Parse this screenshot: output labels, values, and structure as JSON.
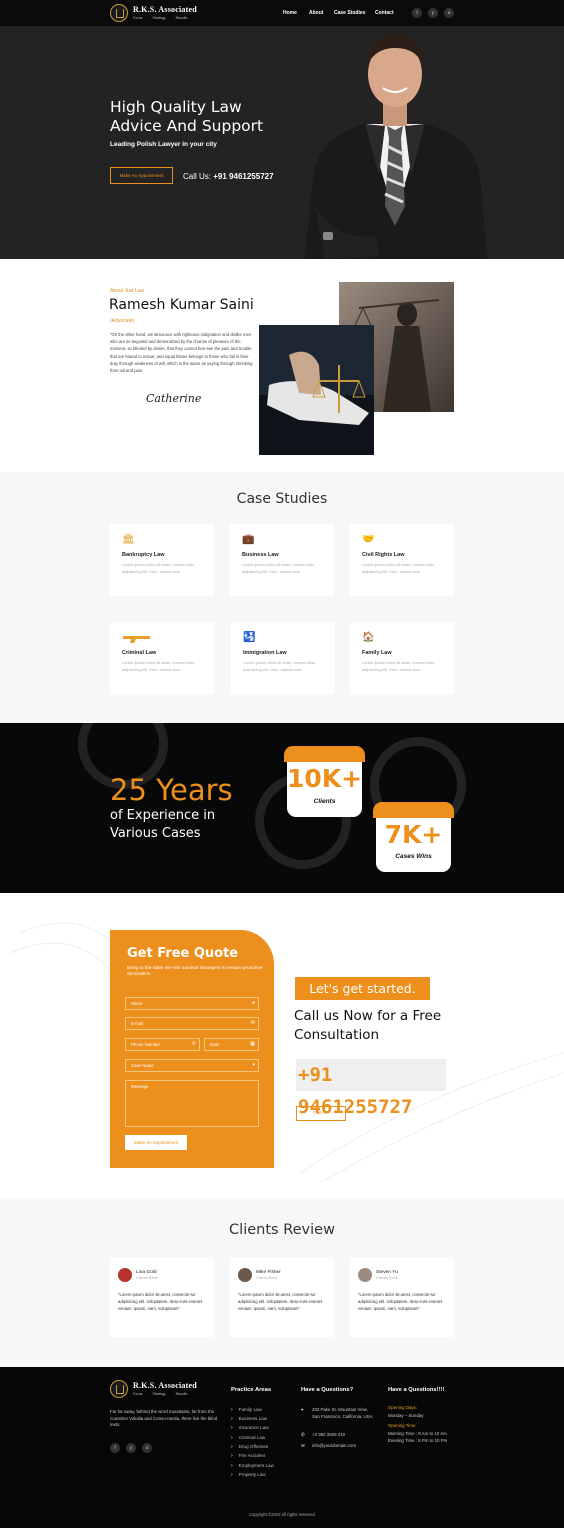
{
  "brand": {
    "name": "R.K.S. Associated",
    "tags": [
      "Focus",
      "Strategy",
      "Results"
    ]
  },
  "nav": {
    "links": [
      "Home",
      "About",
      "Case Studies",
      "Contact"
    ],
    "social": [
      "f",
      "y",
      "o"
    ]
  },
  "hero": {
    "title_line1": "High Quality Law",
    "title_line2": "Advice And Support",
    "subtitle": "Leading Polish Lawyer in your city",
    "button": "Make An Appointment",
    "call_label": "Call Us:",
    "call_number": "+91 9461255727"
  },
  "about": {
    "kicker": "About Just Law",
    "name": "Ramesh Kumar Saini",
    "role": "(Advocate)",
    "body": "\"On the other hand, we denounce with righteous indignation and dislike men who are so beguiled and demoralized by the charms of pleasure of the moment, so blinded by desire, that they cannot fore-see the pain and trouble that are bound to ensue; and equal blame belongs to those who fail in their duty through weakness of will, which is the same as saying through shrinking from toil and pain.",
    "signature": "Catherine"
  },
  "cases": {
    "title": "Case Studies",
    "items": [
      {
        "title": "Bankruptcy Law",
        "icon": "bank-icon",
        "body": "Lorem ipsum dolor sit amet, consec-tetur adipisicing elit. Vero, laboris-sunt"
      },
      {
        "title": "Business Law",
        "icon": "briefcase-icon",
        "body": "Lorem ipsum dolor sit amet, consec-tetur adipisicing elit. Vero, laboris-sunt"
      },
      {
        "title": "Civil Rights Law",
        "icon": "handshake-icon",
        "body": "Lorem ipsum dolor sit amet, consec-tetur adipisicing elit. Vero, laboris-sunt"
      },
      {
        "title": "Criminal Law",
        "icon": "gun-icon",
        "body": "Lorem ipsum dolor sit amet, consec-tetur adipisicing elit. Vero, laboris-sunt"
      },
      {
        "title": "Immigration Law",
        "icon": "passport-icon",
        "body": "Lorem ipsum dolor sit amet, consec-tetur adipisicing elit. Vero, laboris-sunt"
      },
      {
        "title": "Family Law",
        "icon": "family-house-icon",
        "body": "Lorem ipsum dolor sit amet, consec-tetur adipisicing elit. Vero, laboris-sunt"
      }
    ]
  },
  "stats": {
    "years": "25 Years",
    "years_sub1": "of Experience in",
    "years_sub2": "Various Cases",
    "clients_num": "10K+",
    "clients_label": "Clients",
    "cases_num": "7K+",
    "cases_label": "Cases Wins"
  },
  "quote": {
    "title": "Get Free Quote",
    "subtitle": "Bring to the table win-win survival strategies to ensure proactive domination",
    "fields": {
      "name": "Name",
      "email": "E-mail",
      "phone": "Phone Number",
      "date": "Date",
      "case": "Case Name",
      "message": "Message"
    },
    "button": "Make An Appointment",
    "lets": "Let's get started.",
    "call_now": "Call us Now for a Free Consultation",
    "phone": "+91 9461255727",
    "call_button": "Call Us"
  },
  "reviews": {
    "title": "Clients Review",
    "items": [
      {
        "name": "Lina Gold",
        "role": "Clients Rank",
        "text": "\"Lorem ipsum dolor sit amet, consecte-tur adipisicing elit. Voluptatem, dese-runt eveniet veniam. Ipsam, nam, voluptatum\"",
        "avatar": "#b8322a"
      },
      {
        "name": "Mike Fisher",
        "role": "Clients Rank",
        "text": "\"Lorem ipsum dolor sit amet, consecte-tur adipisicing elit. Voluptatem, dese-runt eveniet veniam. Ipsam, nam, voluptatum\"",
        "avatar": "#6b5a4a"
      },
      {
        "name": "Steven Yu",
        "role": "Clients Rank",
        "text": "\"Lorem ipsum dolor sit amet, consecte-tur adipisicing elit. Voluptatem, dese-runt eveniet veniam. Ipsam, nam, voluptatum\"",
        "avatar": "#9a8a80"
      }
    ]
  },
  "footer": {
    "about": "Far far away, behind the word mountains, far from the countries Vokalia and Conso-nantia, there live the blind texts.",
    "practice_title": "Practice Areas",
    "practice": [
      "Family Law",
      "Business Law",
      "Insurance Law",
      "Criminal Law",
      "Drug Offenses",
      "Fire Accident",
      "Employment Law",
      "Property Law"
    ],
    "questions_title": "Have a Questions?",
    "address": "203 Fake St. Mountain View, San Francisco, California, USA",
    "phone": "+2 392 3929 210",
    "email": "info@yourdomain.com",
    "hours_title": "Have a Questions!!!!",
    "opening_days_label": "Opening Days:",
    "opening_days": "Monday – Sunday",
    "opening_time_label": "Opening Time:",
    "morning": "Morning Time : 8 Am to 10 Am",
    "evening": "Evening Time : 5 Pm to 10 Pm",
    "copyright": "Copyright ©2022 All rights reserved"
  },
  "colors": {
    "accent": "#ec8f1c",
    "dark": "#0b0b0b",
    "gold": "#c99b3a"
  }
}
